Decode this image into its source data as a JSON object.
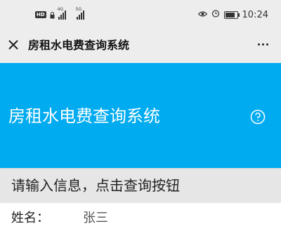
{
  "status_bar": {
    "hd_label": "HD",
    "net1_label": "4G",
    "net2_label": "5G",
    "time": "10:24",
    "battery_level": 0.8
  },
  "title_bar": {
    "title": "房租水电费查询系统"
  },
  "hero": {
    "title": "房租水电费查询系统"
  },
  "prompt": {
    "text": "请输入信息，点击查询按钮"
  },
  "form": {
    "name_label": "姓名：",
    "name_value": "张三"
  },
  "colors": {
    "accent": "#00abf0",
    "title_bar_bg": "#ededed",
    "prompt_bg": "#e6e6e6"
  },
  "icons": {
    "close": "close-icon",
    "more": "more-icon",
    "help": "help-icon",
    "eye": "eye-icon",
    "alarm": "alarm-icon",
    "battery": "battery-icon"
  }
}
